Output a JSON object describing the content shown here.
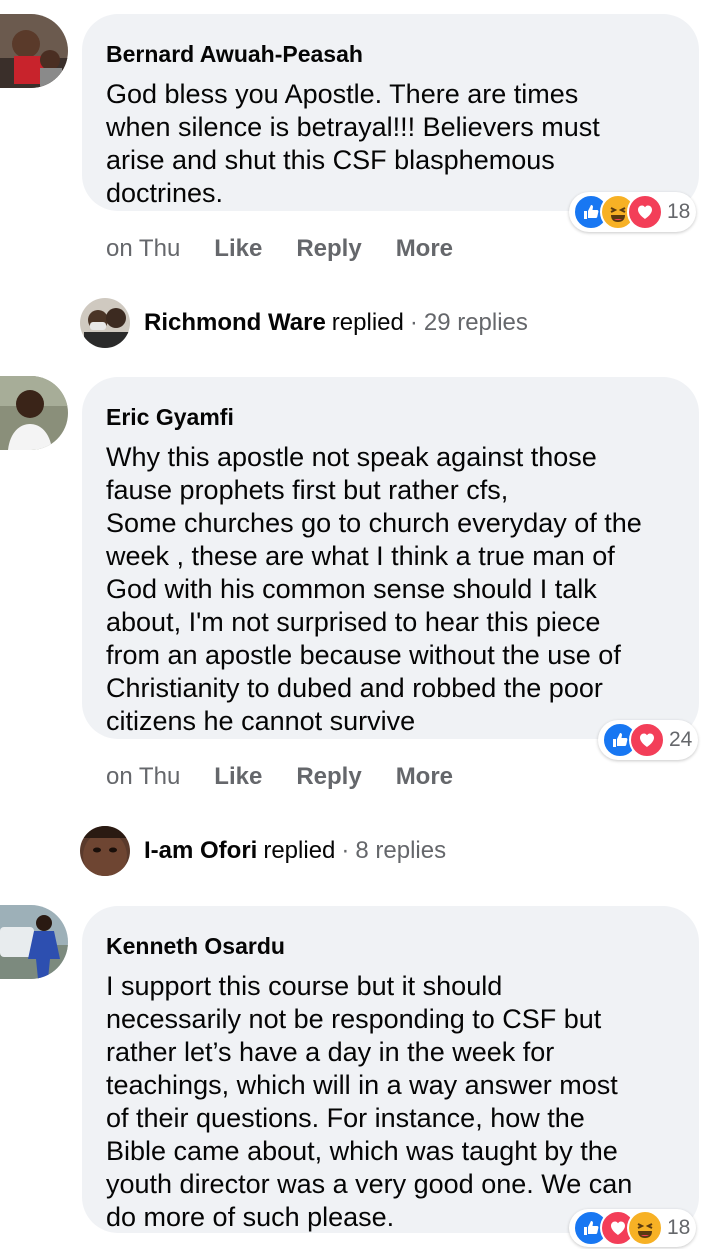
{
  "comments": [
    {
      "author": "Bernard Awuah-Peasah",
      "text": "God bless you Apostle. There are times\nwhen silence is betrayal!!! Believers must\narise and shut this CSF blasphemous\ndoctrines.",
      "reaction_icons": [
        "like-icon",
        "haha-icon",
        "love-icon"
      ],
      "reaction_count": "18",
      "time": "on Thu",
      "actions": [
        "Like",
        "Reply",
        "More"
      ]
    },
    {
      "author": "Eric Gyamfi",
      "text": "Why this apostle not speak against those\nfause prophets first but rather cfs,\nSome churches go to church everyday of the\nweek , these are what I think a true man of\nGod with his common sense should I talk\nabout, I'm not surprised to hear this piece\nfrom an apostle because without the use of\nChristianity to dubed and robbed the poor\ncitizens he cannot survive",
      "reaction_icons": [
        "like-icon",
        "love-icon"
      ],
      "reaction_count": "24",
      "time": "on Thu",
      "actions": [
        "Like",
        "Reply",
        "More"
      ]
    },
    {
      "author": "Kenneth Osardu",
      "text": "I support this course but it should\nnecessarily not be responding to CSF but\nrather let’s have a day in the week for\nteachings, which will in a way answer most\nof their questions. For instance, how the\nBible came about, which was taught by the\nyouth director was a very good one. We can\ndo more of such please.",
      "reaction_icons": [
        "like-icon",
        "love-icon",
        "haha-icon"
      ],
      "reaction_count": "18"
    }
  ],
  "reply_summaries": [
    {
      "name": "Richmond Ware",
      "verb": "replied",
      "separator": "·",
      "count": "29 replies"
    },
    {
      "name": "I-am Ofori",
      "verb": "replied",
      "separator": "·",
      "count": "8 replies"
    }
  ],
  "colors": {
    "bubble": "#f0f2f5",
    "meta_text": "#65676b",
    "like_blue": "#1877f2",
    "love_red": "#f33e58",
    "haha_yellow": "#f7b125"
  }
}
